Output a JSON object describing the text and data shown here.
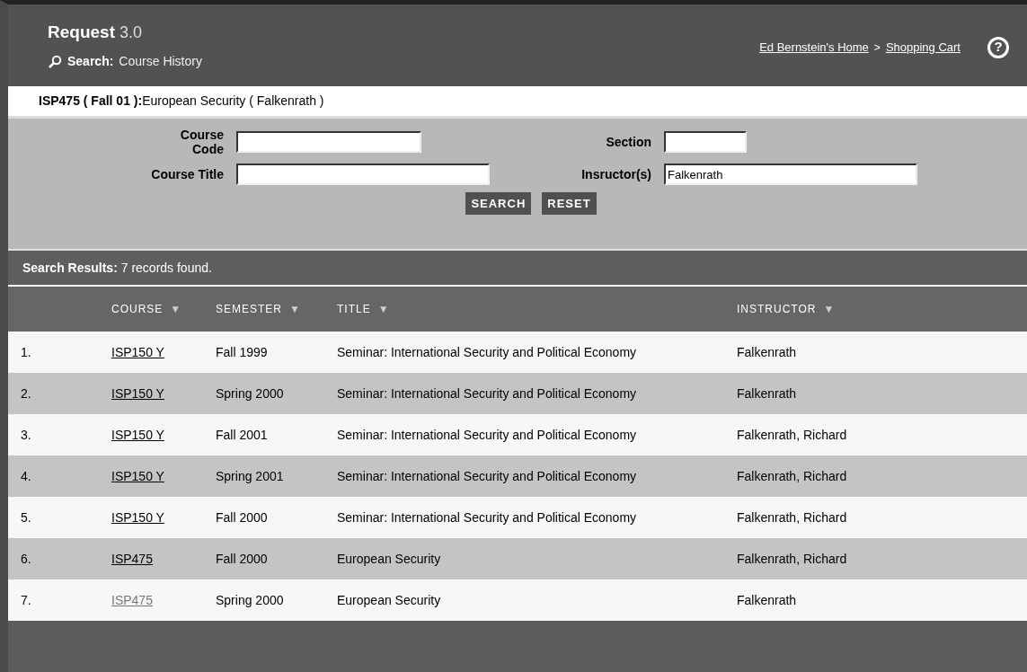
{
  "header": {
    "app_name": "Request",
    "version": "3.0",
    "search_label": "Search:",
    "search_context": "Course History",
    "breadcrumbs": [
      {
        "label": "Ed Bernstein's Home"
      },
      {
        "label": "Shopping Cart",
        "separator": ">"
      }
    ],
    "help": "?"
  },
  "context_bar": {
    "code": "ISP475 ( Fall 01 ):",
    "text": "European Security ( Falkenrath )"
  },
  "form": {
    "fields": [
      {
        "label": "Course Code"
      },
      {
        "label": "Section"
      },
      {
        "label": "Course Title"
      },
      {
        "label": "Insructor(s)",
        "value": "Falkenrath"
      }
    ],
    "buttons": [
      "SEARCH",
      "RESET"
    ]
  },
  "results": {
    "label": "Search Results:",
    "summary": "7 records found."
  },
  "table": {
    "columns": [
      {
        "label": "COURSE",
        "sort": "▼"
      },
      {
        "label": "SEMESTER",
        "sort": "▼"
      },
      {
        "label": "TITLE",
        "sort": "▼"
      },
      {
        "label": "INSTRUCTOR",
        "sort": "▼"
      }
    ],
    "rows": [
      {
        "number": "1.",
        "course": "ISP150 Y",
        "visited": false,
        "semester": "Fall 1999",
        "title": "Seminar: International Security and Political Economy",
        "instructor": "Falkenrath"
      },
      {
        "number": "2.",
        "course": "ISP150 Y",
        "visited": false,
        "semester": "Spring 2000",
        "title": "Seminar: International Security and Political Economy",
        "instructor": "Falkenrath"
      },
      {
        "number": "3.",
        "course": "ISP150 Y",
        "visited": false,
        "semester": "Fall 2001",
        "title": "Seminar: International Security and Political Economy",
        "instructor": "Falkenrath, Richard"
      },
      {
        "number": "4.",
        "course": "ISP150 Y",
        "visited": false,
        "semester": "Spring 2001",
        "title": "Seminar: International Security and Political Economy",
        "instructor": "Falkenrath, Richard"
      },
      {
        "number": "5.",
        "course": "ISP150 Y",
        "visited": false,
        "semester": "Fall 2000",
        "title": "Seminar: International Security and Political Economy",
        "instructor": "Falkenrath, Richard"
      },
      {
        "number": "6.",
        "course": "ISP475",
        "visited": false,
        "semester": "Fall 2000",
        "title": "European Security",
        "instructor": "Falkenrath, Richard"
      },
      {
        "number": "7.",
        "course": "ISP475",
        "visited": true,
        "semester": "Spring 2000",
        "title": "European Security",
        "instructor": "Falkenrath"
      }
    ]
  }
}
